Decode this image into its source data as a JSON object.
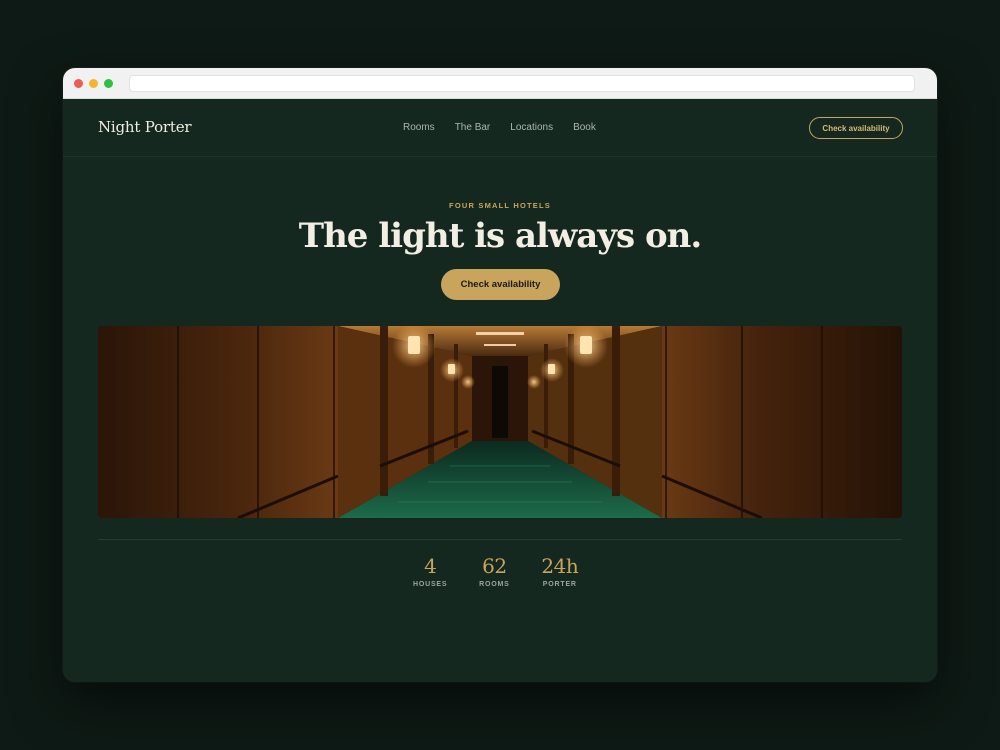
{
  "site": {
    "logo": "Night Porter",
    "nav": [
      {
        "label": "Rooms"
      },
      {
        "label": "The Bar"
      },
      {
        "label": "Locations"
      },
      {
        "label": "Book"
      }
    ],
    "nav_cta": "Check availability"
  },
  "hero": {
    "eyebrow": "FOUR SMALL HOTELS",
    "headline": "The light is always on.",
    "cta": "Check availability",
    "image_subject": "hotel hallway with wall sconces and green carpet"
  },
  "stats": [
    {
      "value": "4",
      "label": "HOUSES"
    },
    {
      "value": "62",
      "label": "ROOMS"
    },
    {
      "value": "24h",
      "label": "PORTER"
    }
  ],
  "colors": {
    "background": "#0e1a15",
    "page": "#142820",
    "accent": "#c9a45c",
    "headline": "#f3eee3"
  }
}
